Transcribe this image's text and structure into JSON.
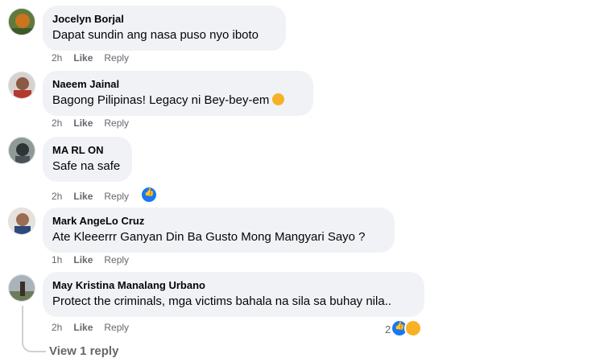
{
  "comments": [
    {
      "author": "Jocelyn Borjal",
      "text": "Dapat sundin ang nasa puso nyo iboto",
      "time": "2h",
      "like": "Like",
      "reply": "Reply"
    },
    {
      "author": "Naeem Jainal",
      "text": "Bagong Pilipinas! Legacy ni Bey-bey-em",
      "time": "2h",
      "like": "Like",
      "reply": "Reply",
      "emoji": "laughing-emoji"
    },
    {
      "author": "MA RL ON",
      "text": "Safe na safe",
      "time": "2h",
      "like": "Like",
      "reply": "Reply",
      "reactions": [
        "like"
      ]
    },
    {
      "author": "Mark AngeLo Cruz",
      "text": "Ate Kleeerrr Ganyan Din Ba Gusto Mong Mangyari Sayo ?",
      "time": "1h",
      "like": "Like",
      "reply": "Reply"
    },
    {
      "author": "May Kristina Manalang Urbano",
      "text": "Protect the criminals, mga victims bahala na sila sa buhay nila..",
      "time": "2h",
      "like": "Like",
      "reply": "Reply",
      "reactions": [
        "like",
        "haha"
      ],
      "reaction_count": "2"
    }
  ],
  "view_replies": "View 1 reply",
  "colors": {
    "bubble": "#f0f2f5",
    "meta": "#65676b",
    "like_blue": "#1877f2",
    "haha_yellow": "#f7b125"
  }
}
